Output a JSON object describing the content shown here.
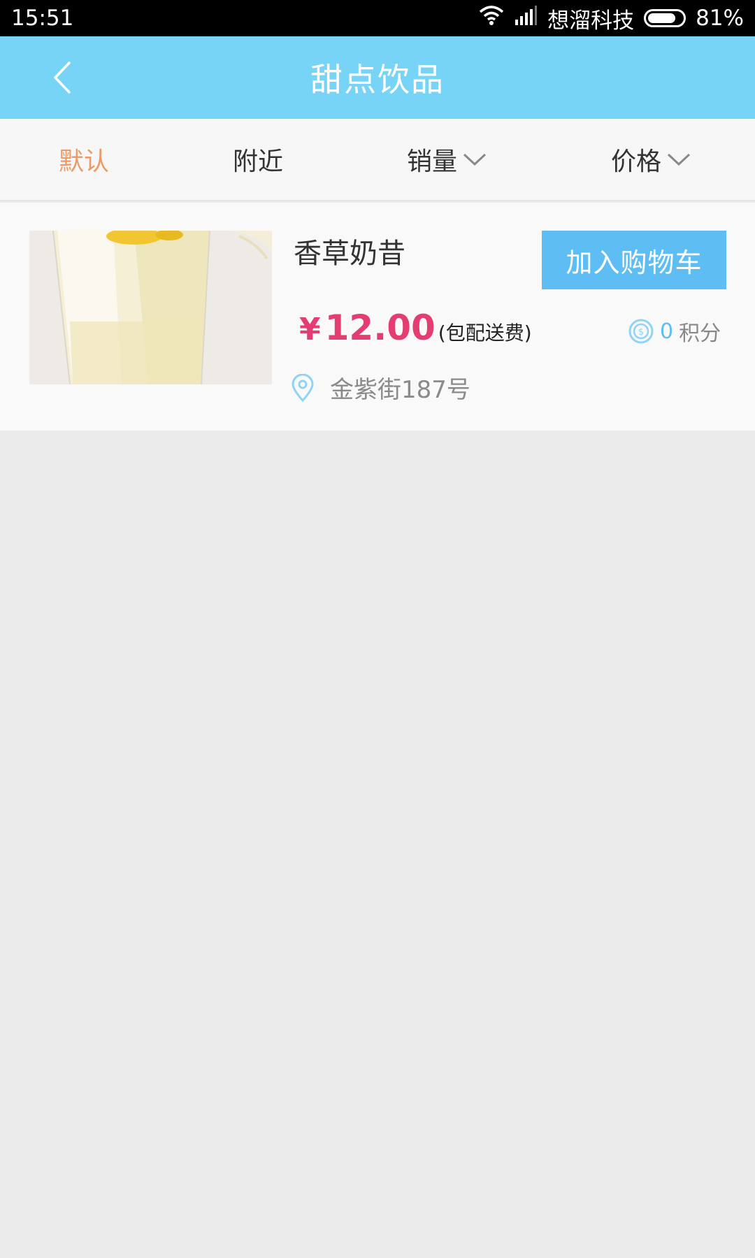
{
  "status_bar": {
    "time": "15:51",
    "carrier": "想溜科技",
    "battery": "81%",
    "battery_level": 0.81
  },
  "header": {
    "title": "甜点饮品",
    "back_icon": "chevron-left-icon"
  },
  "filters": [
    {
      "label": "默认",
      "active": true
    },
    {
      "label": "附近",
      "active": false
    },
    {
      "label": "销量",
      "active": false,
      "has_dropdown": true
    },
    {
      "label": "价格",
      "active": false,
      "has_dropdown": true
    }
  ],
  "product": {
    "name": "香草奶昔",
    "cart_button": "加入购物车",
    "price_symbol": "¥",
    "price": "12.00",
    "price_note": "(包配送费)",
    "points_value": "0",
    "points_label": "积分",
    "address": "金紫街187号"
  },
  "colors": {
    "header": "#77d4f7",
    "accent_blue": "#5ebef4",
    "price_red": "#e43d72",
    "active_filter": "#ec9a68",
    "background": "#ebebeb"
  }
}
